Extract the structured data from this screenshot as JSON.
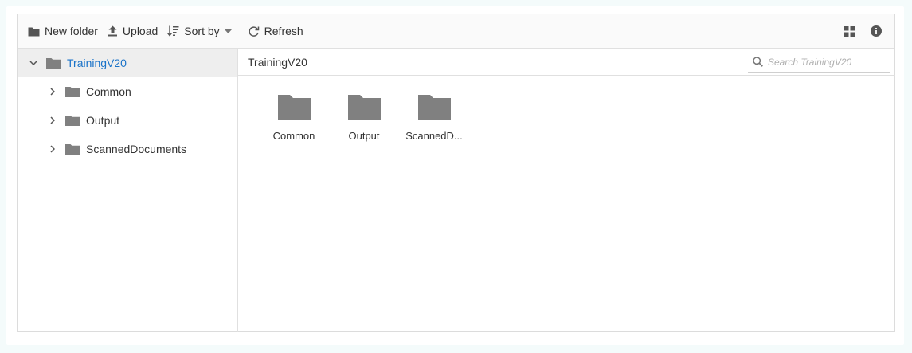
{
  "toolbar": {
    "new_folder_label": "New folder",
    "upload_label": "Upload",
    "sort_by_label": "Sort by",
    "refresh_label": "Refresh",
    "view_icon": "grid-view-icon",
    "details_icon": "info-icon"
  },
  "tree": {
    "root": {
      "label": "TrainingV20",
      "expanded": true,
      "selected": true
    },
    "children": [
      {
        "label": "Common"
      },
      {
        "label": "Output"
      },
      {
        "label": "ScannedDocuments"
      }
    ]
  },
  "address_bar": {
    "path": "TrainingV20",
    "search_placeholder": "Search TrainingV20"
  },
  "files": [
    {
      "name": "Common",
      "display": "Common"
    },
    {
      "name": "Output",
      "display": "Output"
    },
    {
      "name": "ScannedDocuments",
      "display": "ScannedD..."
    }
  ],
  "colors": {
    "folder_icon": "#808080",
    "selected_text": "#1a73c9",
    "selected_bg": "#eeeeee"
  }
}
